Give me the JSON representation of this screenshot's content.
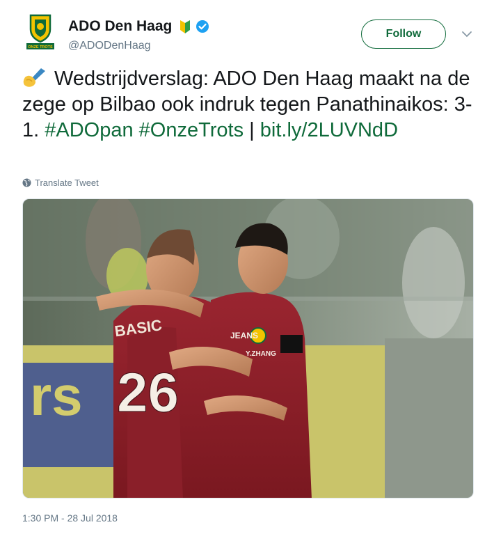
{
  "account": {
    "display_name": "ADO Den Haag",
    "handle": "@ADODenHaag",
    "avatar_text": "ONZE TROTS",
    "verified": true
  },
  "follow_button": {
    "label": "Follow"
  },
  "tweet": {
    "text_part1": "Wedstrijdverslag: ADO Den Haag maakt na de zege op Bilbao ook indruk tegen Panathinaikos: 3-1. ",
    "hashtag1": "#ADOpan",
    "hashtag2": "#OnzeTrots",
    "separator": " | ",
    "link": "bit.ly/2LUVNdD",
    "emoji_icon": "writing-hand-icon"
  },
  "translate_label": "Translate Tweet",
  "media": {
    "player_left_name": "BASIC",
    "player_left_number": "26",
    "player_right_name": "Y.ZHANG",
    "shirt_sponsor": "JEANS"
  },
  "timestamp": "1:30 PM - 28 Jul 2018",
  "colors": {
    "brand_green": "#0f6a3a",
    "text": "#14171a",
    "secondary_text": "#657786",
    "verified_blue": "#1da1f2",
    "kit_red": "#8e1d26"
  }
}
